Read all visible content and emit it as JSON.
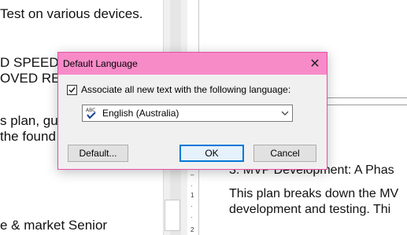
{
  "document": {
    "left_lines": [
      "Test on various devices.",
      "D SPEED V",
      "OVED RES",
      "s plan, guid",
      " the found",
      "e & market Senior"
    ],
    "right_heading": "3. MVP Development: A Phas",
    "right_lines": [
      "This plan breaks down the MV",
      "development and testing. Thi"
    ],
    "ruler_marks": [
      "1",
      "2"
    ]
  },
  "dialog": {
    "title": "Default Language",
    "close_label": "✕",
    "checkbox_label": "Associate all new text with the following language:",
    "checkbox_checked": true,
    "language_selected": "English (Australia)",
    "language_icon": "spellcheck-abc-icon",
    "buttons": {
      "default_label": "Default...",
      "ok_label": "OK",
      "cancel_label": "Cancel"
    },
    "colors": {
      "titlebar": "#f78bc8",
      "border": "#e64ea6",
      "ok_accent": "#0078d7"
    }
  }
}
